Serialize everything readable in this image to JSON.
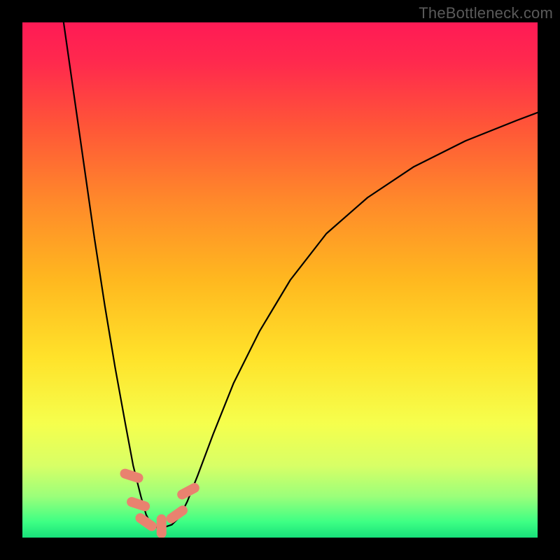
{
  "watermark": "TheBottleneck.com",
  "chart_data": {
    "type": "line",
    "title": "",
    "xlabel": "",
    "ylabel": "",
    "xlim": [
      0,
      100
    ],
    "ylim": [
      0,
      100
    ],
    "grid": false,
    "legend": false,
    "gradient_stops": [
      {
        "offset": 0.0,
        "color": "#ff1a55"
      },
      {
        "offset": 0.08,
        "color": "#ff2a4d"
      },
      {
        "offset": 0.2,
        "color": "#ff5538"
      },
      {
        "offset": 0.35,
        "color": "#ff8a2a"
      },
      {
        "offset": 0.5,
        "color": "#ffb81f"
      },
      {
        "offset": 0.65,
        "color": "#ffe22a"
      },
      {
        "offset": 0.78,
        "color": "#f5ff4d"
      },
      {
        "offset": 0.86,
        "color": "#d8ff66"
      },
      {
        "offset": 0.92,
        "color": "#9bff7a"
      },
      {
        "offset": 0.97,
        "color": "#3dff84"
      },
      {
        "offset": 1.0,
        "color": "#18e07a"
      }
    ],
    "series": [
      {
        "name": "bottleneck-curve",
        "color": "#000000",
        "x": [
          8.0,
          10.0,
          12.0,
          14.0,
          16.0,
          18.0,
          20.0,
          21.5,
          23.0,
          24.0,
          25.0,
          26.0,
          27.5,
          29.0,
          30.5,
          32.0,
          34.0,
          37.0,
          41.0,
          46.0,
          52.0,
          59.0,
          67.0,
          76.0,
          86.0,
          96.0,
          100.0
        ],
        "y": [
          100.0,
          86.0,
          72.0,
          58.0,
          45.0,
          33.0,
          22.0,
          14.0,
          8.0,
          4.5,
          2.5,
          2.0,
          2.0,
          2.5,
          4.0,
          7.0,
          12.0,
          20.0,
          30.0,
          40.0,
          50.0,
          59.0,
          66.0,
          72.0,
          77.0,
          81.0,
          82.5
        ]
      }
    ],
    "markers": {
      "name": "highlight-lozenges",
      "color": "#e9826f",
      "points": [
        {
          "x": 21.2,
          "y": 12.0,
          "angle": -72
        },
        {
          "x": 22.5,
          "y": 6.5,
          "angle": -72
        },
        {
          "x": 24.0,
          "y": 3.0,
          "angle": -55
        },
        {
          "x": 27.0,
          "y": 2.2,
          "angle": 0
        },
        {
          "x": 30.0,
          "y": 4.5,
          "angle": 55
        },
        {
          "x": 32.2,
          "y": 9.0,
          "angle": 62
        }
      ]
    }
  }
}
